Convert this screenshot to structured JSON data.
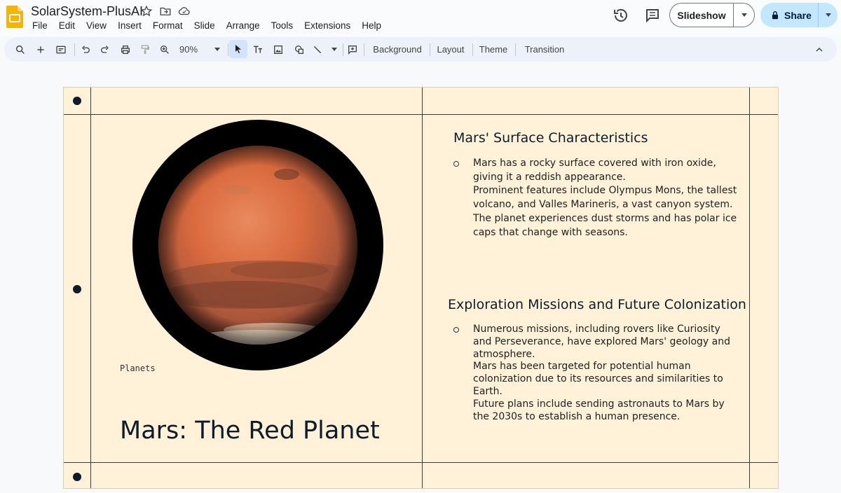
{
  "app": {
    "doc_title": "SolarSystem-PlusAI",
    "menu": [
      "File",
      "Edit",
      "View",
      "Insert",
      "Format",
      "Slide",
      "Arrange",
      "Tools",
      "Extensions",
      "Help"
    ],
    "slideshow_label": "Slideshow",
    "share_label": "Share"
  },
  "toolbar": {
    "zoom": "90%",
    "background_label": "Background",
    "layout_label": "Layout",
    "theme_label": "Theme",
    "transition_label": "Transition"
  },
  "slide": {
    "caption": "Planets",
    "title": "Mars: The Red Planet",
    "sections": [
      {
        "heading": "Mars' Surface Characteristics",
        "lines": [
          "Mars has a rocky surface covered with iron oxide,",
          "giving it a reddish appearance.",
          "Prominent features include Olympus Mons, the tallest",
          "volcano, and Valles Marineris, a vast canyon system.",
          "The planet experiences dust storms and has polar ice",
          "caps that change with seasons."
        ]
      },
      {
        "heading": "Exploration Missions and Future Colonization",
        "lines": [
          "Numerous missions, including rovers like Curiosity",
          "and Perseverance, have explored Mars' geology and",
          "atmosphere.",
          "Mars has been targeted for potential human",
          "colonization due to its resources and similarities to",
          "Earth.",
          "Future plans include sending astronauts to Mars by",
          "the 2030s to establish a human presence."
        ]
      }
    ]
  },
  "colors": {
    "slide_background": "#fff2d8",
    "accent_blue": "#c2e7ff",
    "mars_orange": "#d96a3e",
    "text_dark": "#0f1b2b"
  }
}
